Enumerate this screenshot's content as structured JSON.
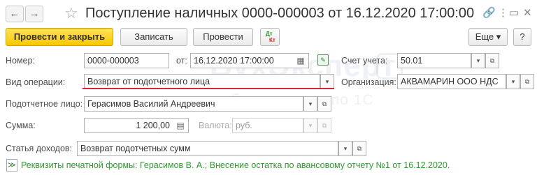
{
  "window": {
    "title": "Поступление наличных 0000-000003 от 16.12.2020 17:00:00",
    "back_glyph": "←",
    "forward_glyph": "→",
    "star_glyph": "☆",
    "link_glyph": "🔗",
    "more_glyph": "⋮",
    "restore_glyph": "▭",
    "close_glyph": "✕"
  },
  "toolbar": {
    "post_and_close": "Провести и закрыть",
    "save": "Записать",
    "post": "Провести",
    "dt_label": "Дт",
    "kt_label": "Кт",
    "more": "Еще ▾",
    "help": "?"
  },
  "form": {
    "number_label": "Номер:",
    "number_value": "0000-000003",
    "date_label": "от:",
    "date_value": "16.12.2020 17:00:00",
    "account_label": "Счет учета:",
    "account_value": "50.01",
    "operation_label": "Вид операции:",
    "operation_value": "Возврат от подотчетного лица",
    "organization_label": "Организация:",
    "organization_value": "АКВАМАРИН ООО НДС",
    "person_label": "Подотчетное лицо:",
    "person_value": "Герасимов Василий Андреевич",
    "sum_label": "Сумма:",
    "sum_value": "1 200,00",
    "currency_label": "Валюта:",
    "currency_value": "руб.",
    "income_label": "Статья доходов:",
    "income_value": "Возврат подотчетных сумм"
  },
  "footer": {
    "print_requisites": "Реквизиты печатной формы: Герасимов В. А.; Внесение остатка по авансовому отчету №1 от 16.12.2020."
  },
  "watermark": {
    "brand": "БухЭксперт",
    "tagline": "база ответов по 1С"
  },
  "icons": {
    "dropdown": "▾",
    "open": "⧉",
    "calendar": "▦",
    "calculator": "▤",
    "expand": "≫"
  }
}
